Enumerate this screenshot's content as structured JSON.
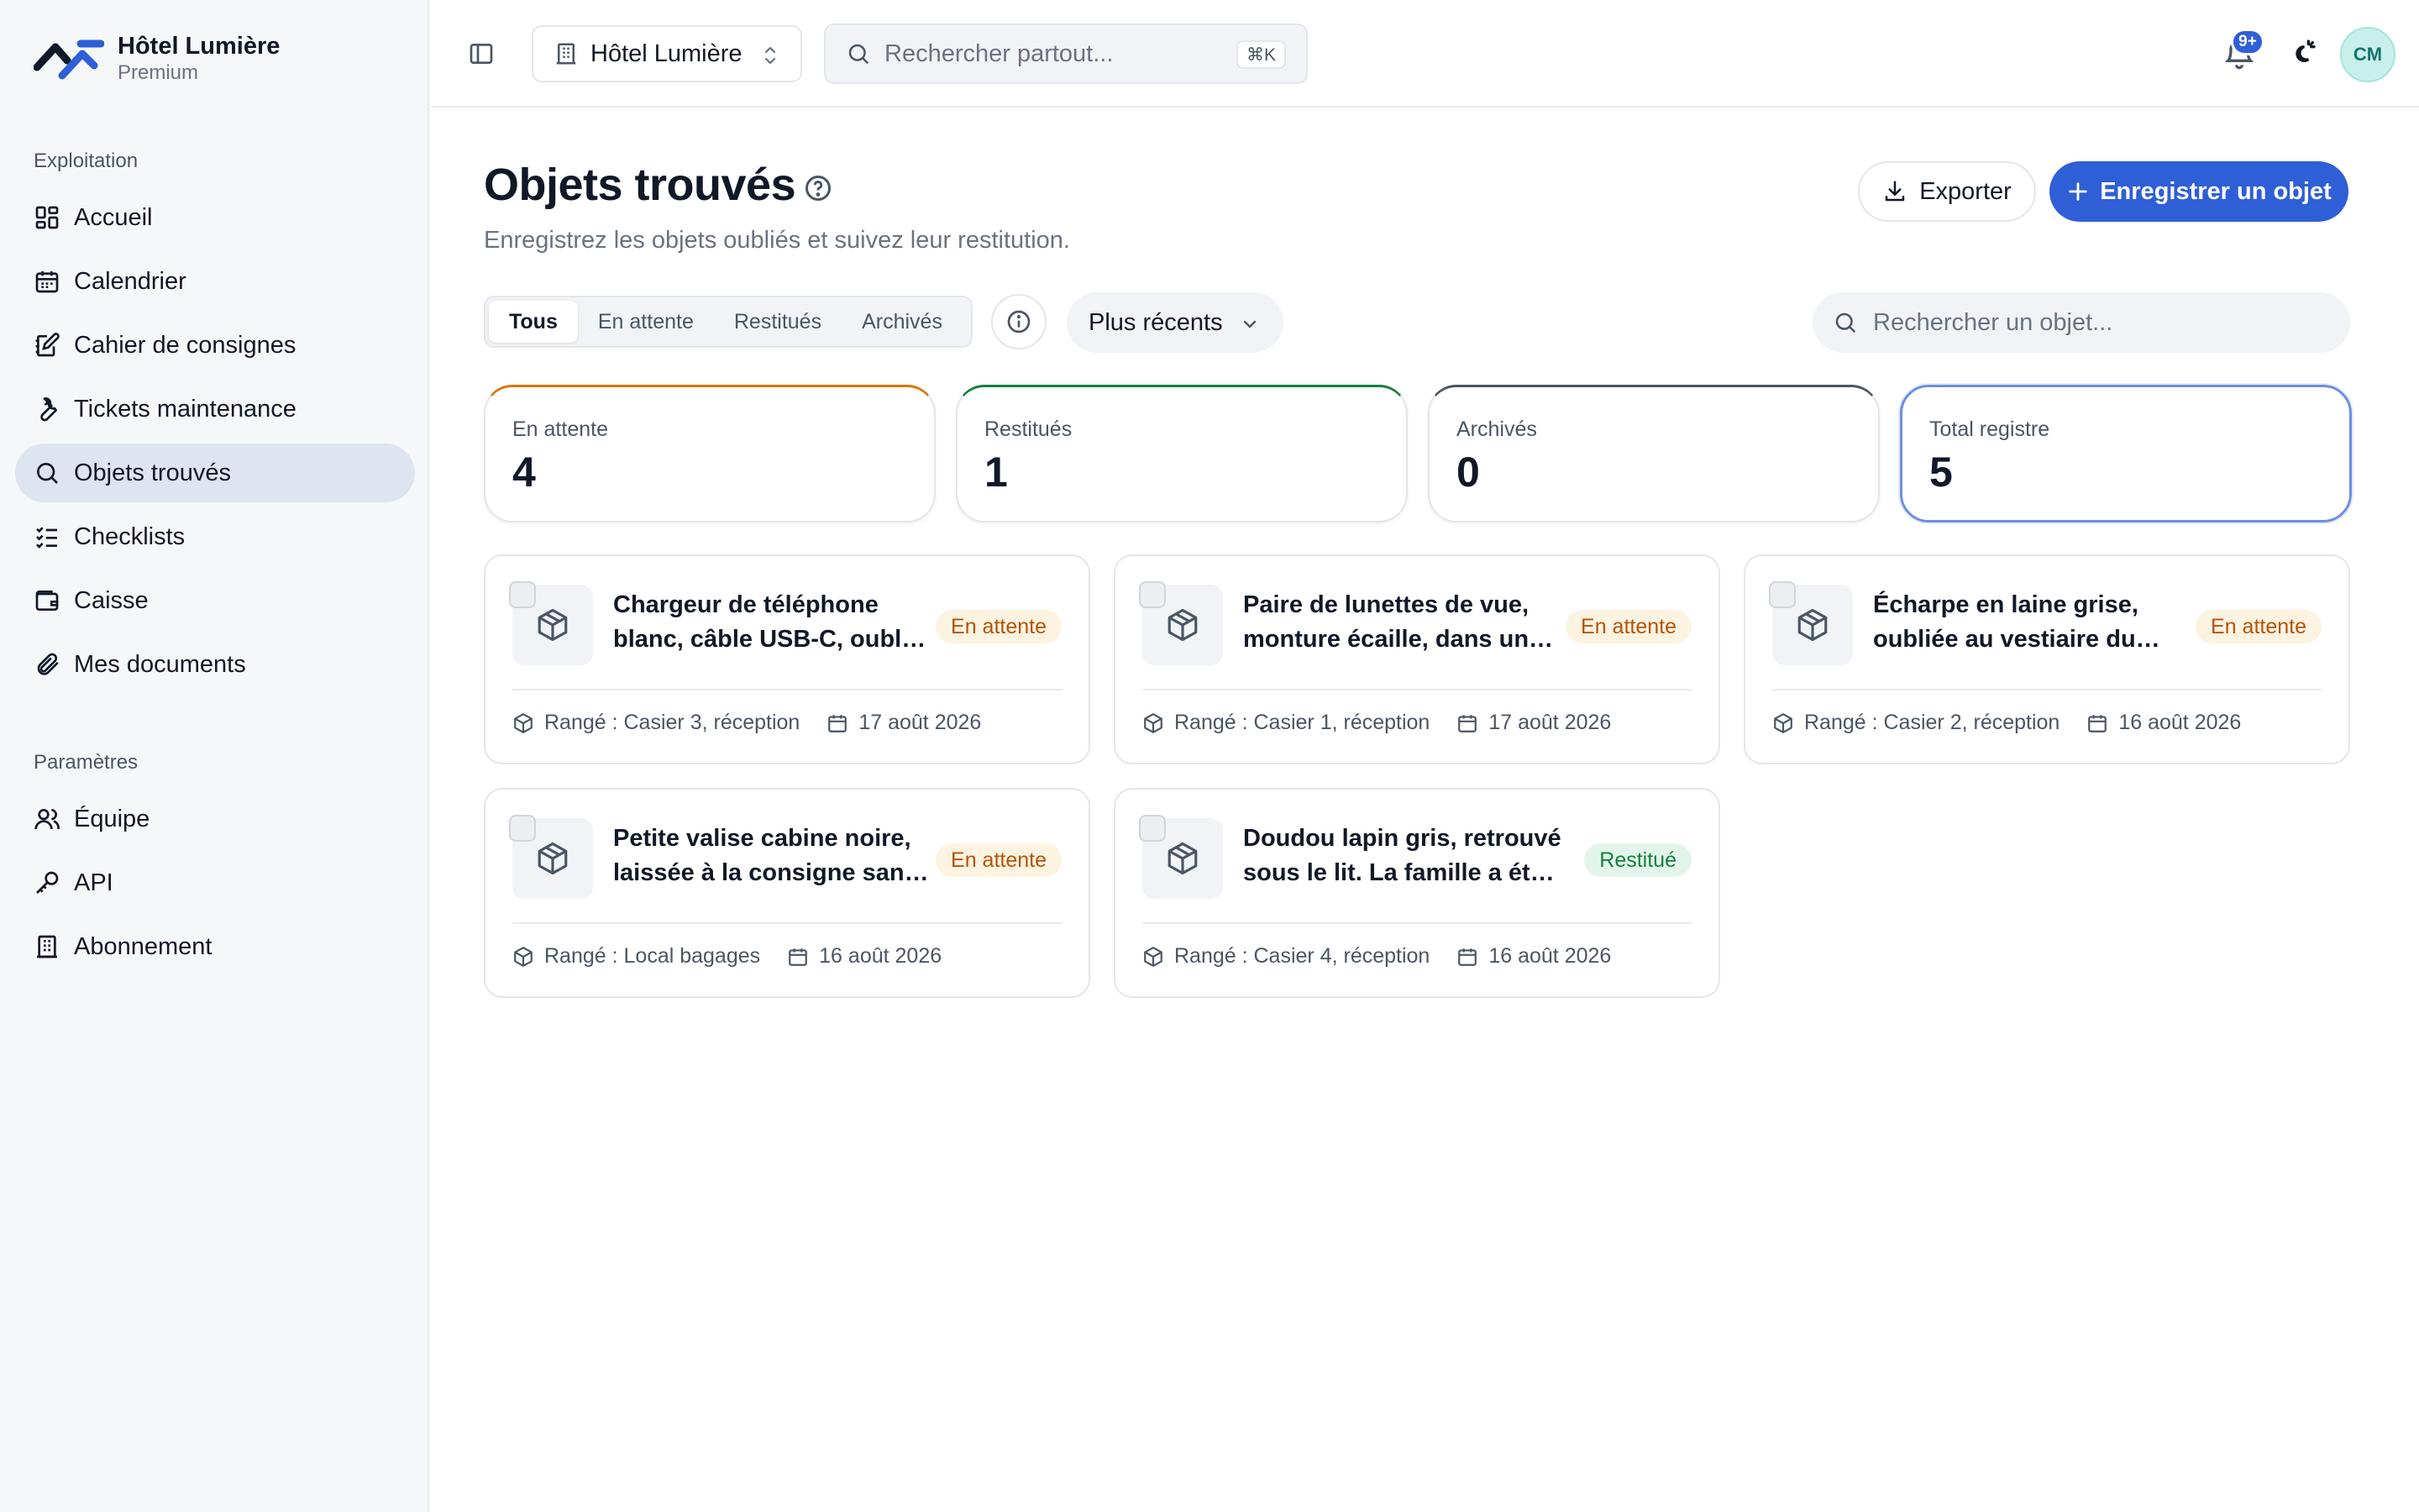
{
  "brand": {
    "name": "Hôtel Lumière",
    "plan": "Premium"
  },
  "sidebar": {
    "sections": [
      {
        "label": "Exploitation"
      },
      {
        "label": "Paramètres"
      }
    ],
    "items": [
      {
        "label": "Accueil",
        "icon": "dashboard-icon"
      },
      {
        "label": "Calendrier",
        "icon": "calendar-icon"
      },
      {
        "label": "Cahier de consignes",
        "icon": "notebook-icon"
      },
      {
        "label": "Tickets maintenance",
        "icon": "wrench-icon"
      },
      {
        "label": "Objets trouvés",
        "icon": "search-icon",
        "active": true
      },
      {
        "label": "Checklists",
        "icon": "checklist-icon"
      },
      {
        "label": "Caisse",
        "icon": "wallet-icon"
      },
      {
        "label": "Mes documents",
        "icon": "paperclip-icon"
      },
      {
        "label": "Équipe",
        "icon": "users-icon"
      },
      {
        "label": "API",
        "icon": "key-icon"
      },
      {
        "label": "Abonnement",
        "icon": "building-icon"
      }
    ]
  },
  "topbar": {
    "hotel_selector": "Hôtel Lumière",
    "search_placeholder": "Rechercher partout...",
    "search_shortcut": "⌘K",
    "notification_count": "9+",
    "avatar_initials": "CM"
  },
  "page": {
    "title": "Objets trouvés",
    "subtitle": "Enregistrez les objets oubliés et suivez leur restitution.",
    "export_label": "Exporter",
    "register_label": "Enregistrer un objet"
  },
  "filters": {
    "tabs": [
      {
        "label": "Tous",
        "active": true
      },
      {
        "label": "En attente"
      },
      {
        "label": "Restitués"
      },
      {
        "label": "Archivés"
      }
    ],
    "sort_label": "Plus récents",
    "search_placeholder": "Rechercher un objet..."
  },
  "stats": [
    {
      "label": "En attente",
      "value": "4",
      "color": "#d97706"
    },
    {
      "label": "Restitués",
      "value": "1",
      "color": "#15803d"
    },
    {
      "label": "Archivés",
      "value": "0",
      "color": "#4b5563"
    },
    {
      "label": "Total registre",
      "value": "5",
      "color": "#2f5fd6"
    }
  ],
  "items": [
    {
      "title": "Chargeur de téléphone blanc, câble USB-C, oublié dans la chambre",
      "status": "En attente",
      "status_type": "pending",
      "location": "Rangé : Casier 3, réception",
      "date": "17 août 2026"
    },
    {
      "title": "Paire de lunettes de vue, monture écaille, dans un étui noir",
      "status": "En attente",
      "status_type": "pending",
      "location": "Rangé : Casier 1, réception",
      "date": "17 août 2026"
    },
    {
      "title": "Écharpe en laine grise, oubliée au vestiaire du restaurant",
      "status": "En attente",
      "status_type": "pending",
      "location": "Rangé : Casier 2, réception",
      "date": "16 août 2026"
    },
    {
      "title": "Petite valise cabine noire, laissée à la consigne sans étiquette",
      "status": "En attente",
      "status_type": "pending",
      "location": "Rangé : Local bagages",
      "date": "16 août 2026"
    },
    {
      "title": "Doudou lapin gris, retrouvé sous le lit. La famille a été contactée",
      "status": "Restitué",
      "status_type": "returned",
      "location": "Rangé : Casier 4, réception",
      "date": "16 août 2026"
    }
  ],
  "colors": {
    "accent": "#2f5fd6",
    "pending": "#b45309",
    "returned": "#15803d"
  }
}
